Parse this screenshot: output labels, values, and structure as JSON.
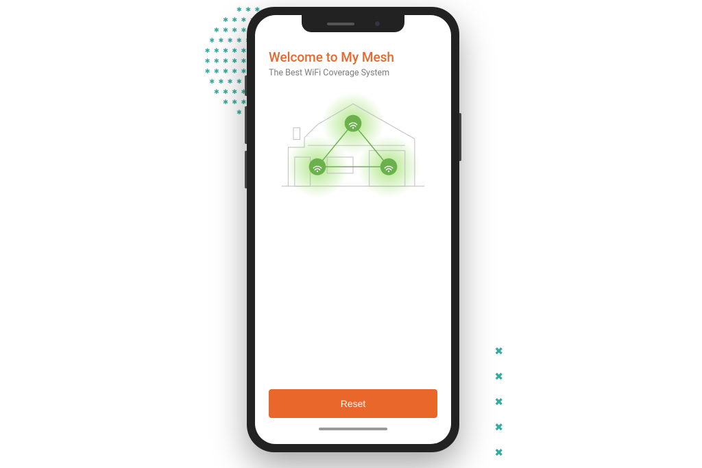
{
  "app": {
    "title": "Welcome to My Mesh",
    "subtitle": "The Best WiFi Coverage System",
    "reset_button_label": "Reset"
  },
  "colors": {
    "accent": "#ea672c",
    "subtitle": "#7c7c7c",
    "illustration_green": "#8cc63f",
    "decor_teal": "#2aa79b"
  }
}
